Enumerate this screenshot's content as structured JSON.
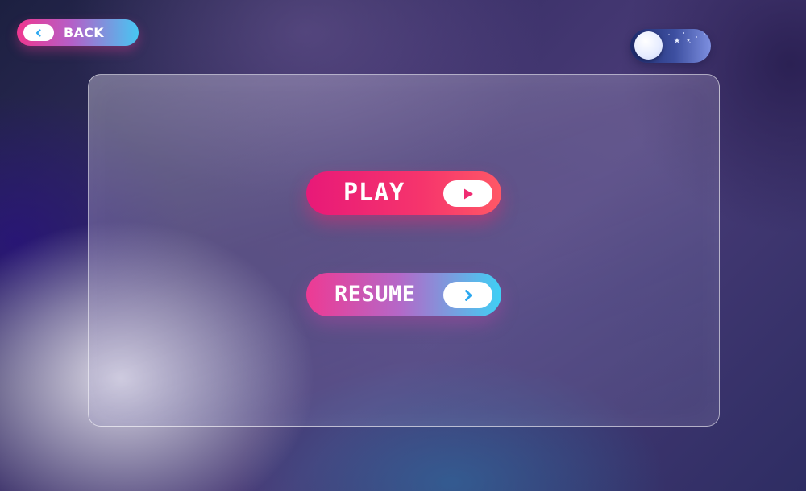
{
  "header": {
    "back_label": "BACK",
    "back_icon": "chevron-left-icon"
  },
  "theme_toggle": {
    "state": "night",
    "icon": "stars-icon"
  },
  "menu": {
    "play_label": "PLAY",
    "play_icon": "play-icon",
    "resume_label": "RESUME",
    "resume_icon": "chevron-right-icon"
  },
  "colors": {
    "play_gradient_start": "#e81978",
    "play_gradient_end": "#ff5866",
    "resume_gradient_start": "#ee3a93",
    "resume_gradient_end": "#3fd0f5",
    "icon_blue": "#2aa8f0",
    "icon_pink": "#f02c73"
  }
}
